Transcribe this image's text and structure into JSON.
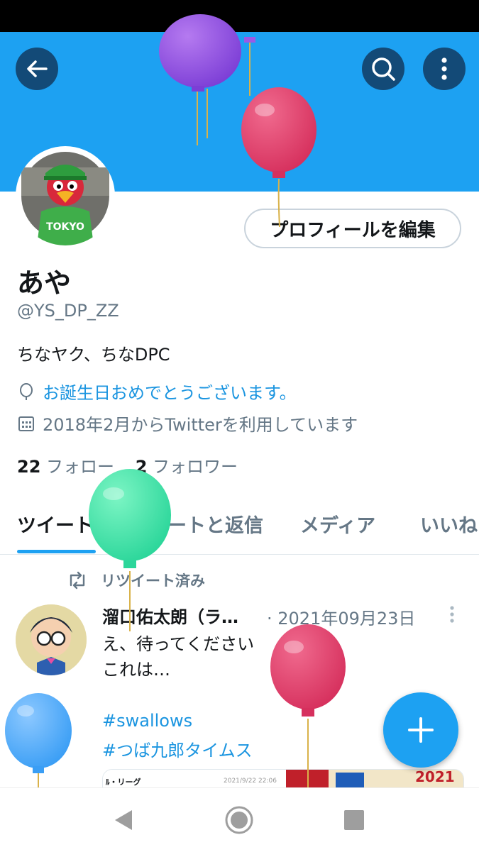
{
  "header": {
    "back_icon": "arrow-left-icon",
    "search_icon": "search-icon",
    "more_icon": "more-vertical-icon",
    "banner_color": "#1da1f2"
  },
  "profile": {
    "edit_label": "プロフィールを編集",
    "name": "あや",
    "handle": "@YS_DP_ZZ",
    "bio": "ちなヤク、ちなDPC",
    "birthday_text": "お誕生日おめでとうございます。",
    "joined_text": "2018年2月からTwitterを利用しています",
    "following_count": "22",
    "following_label": "フォロー",
    "followers_count": "2",
    "followers_label": "フォロワー"
  },
  "tabs": [
    {
      "label": "ツイート",
      "active": true
    },
    {
      "label": "ツイートと返信",
      "active": false
    },
    {
      "label": "メディア",
      "active": false
    },
    {
      "label": "いいね",
      "active": false
    }
  ],
  "tweet": {
    "retweet_label": "リツイート済み",
    "author": "溜口佑太朗（ラ…",
    "date": "· 2021年09月23日",
    "text_line1": "え、待ってください",
    "text_line2": "これは…",
    "hashtag1": "#swallows",
    "hashtag2": "#つば九郎タイムス",
    "media_label": "ﾙ・リーグ",
    "media_date": "2021/9/22 22:06",
    "media_year": "2021"
  },
  "accent_color": "#1da1f2",
  "fab_icon": "plus-icon",
  "navbar": {
    "back_icon": "nav-back-icon",
    "home_icon": "nav-home-icon",
    "recents_icon": "nav-recents-icon"
  }
}
